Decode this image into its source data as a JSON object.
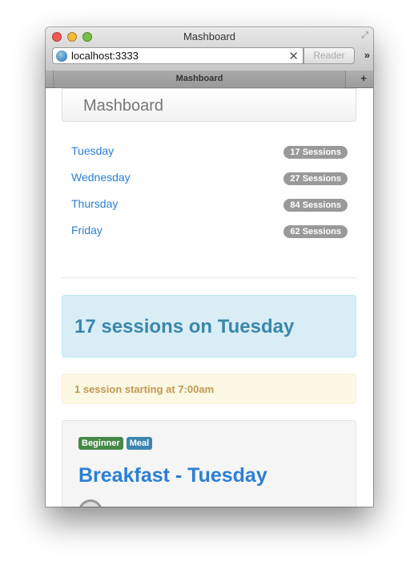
{
  "window": {
    "title": "Mashboard",
    "url": "localhost:3333",
    "reader_label": "Reader",
    "tab_title": "Mashboard"
  },
  "navbar": {
    "brand": "Mashboard"
  },
  "days": [
    {
      "label": "Tuesday",
      "badge": "17 Sessions"
    },
    {
      "label": "Wednesday",
      "badge": "27 Sessions"
    },
    {
      "label": "Thursday",
      "badge": "84 Sessions"
    },
    {
      "label": "Friday",
      "badge": "62 Sessions"
    }
  ],
  "hero": {
    "heading": "17 sessions on Tuesday"
  },
  "alert": {
    "text": "1 session starting at 7:00am"
  },
  "session": {
    "labels": [
      {
        "text": "Beginner",
        "color": "#468847"
      },
      {
        "text": "Meal",
        "color": "#3a87ad"
      }
    ],
    "title": "Breakfast - Tuesday"
  }
}
